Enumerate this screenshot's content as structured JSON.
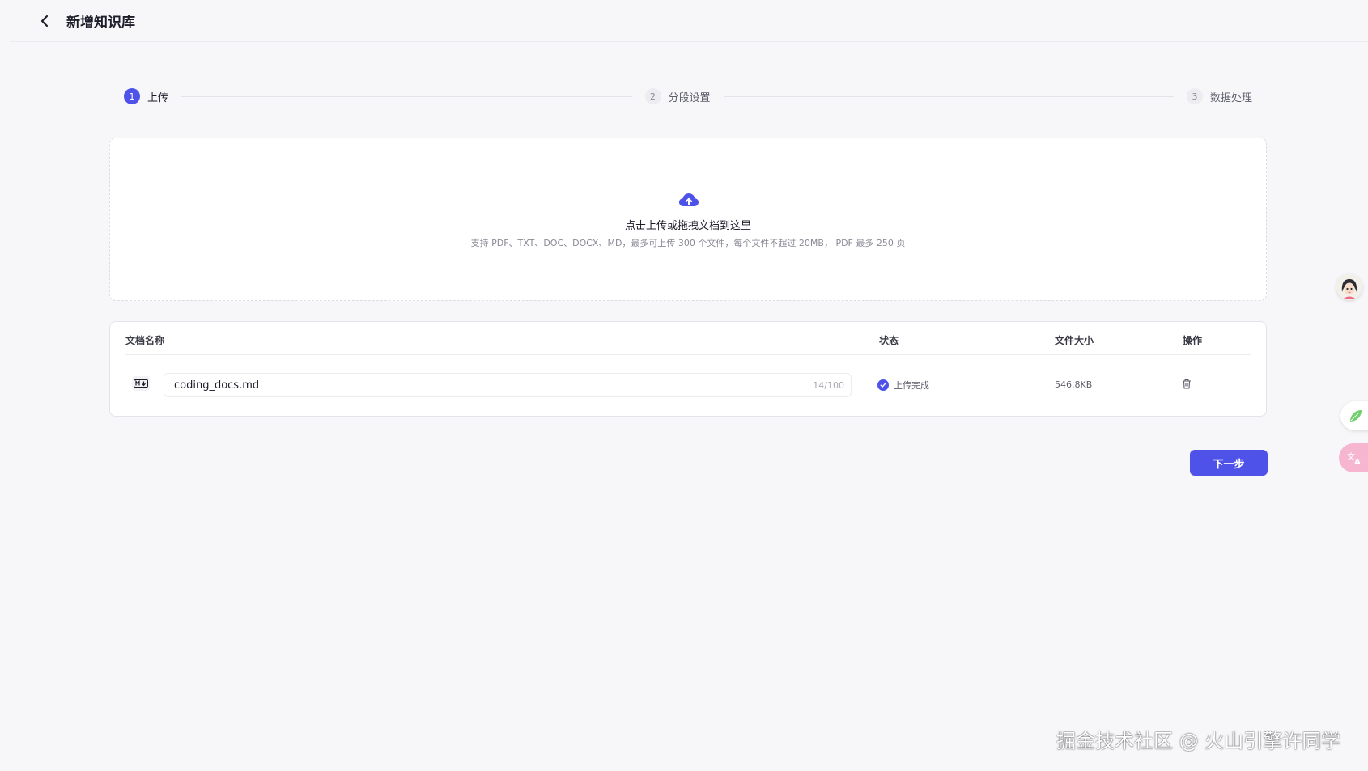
{
  "header": {
    "title": "新增知识库",
    "back_icon": "chevron-left-icon"
  },
  "steps": [
    {
      "number": "1",
      "label": "上传",
      "state": "active"
    },
    {
      "number": "2",
      "label": "分段设置",
      "state": "inactive"
    },
    {
      "number": "3",
      "label": "数据处理",
      "state": "inactive"
    }
  ],
  "upload": {
    "icon": "cloud-upload-icon",
    "title": "点击上传或拖拽文档到这里",
    "hint": "支持 PDF、TXT、DOC、DOCX、MD，最多可上传 300 个文件，每个文件不超过 20MB， PDF 最多 250 页"
  },
  "table": {
    "columns": {
      "name": "文档名称",
      "status": "状态",
      "size": "文件大小",
      "action": "操作"
    },
    "rows": [
      {
        "type_icon": "markdown-file-icon",
        "name": "coding_docs.md",
        "char_count": "14/100",
        "status": "上传完成",
        "size": "546.8KB",
        "action_icon": "trash-icon"
      }
    ]
  },
  "next_button": {
    "label": "下一步"
  },
  "watermark": "掘金技术社区 @ 火山引擎许同学",
  "colors": {
    "accent": "#4f52e8",
    "background": "#f7f7fa"
  }
}
